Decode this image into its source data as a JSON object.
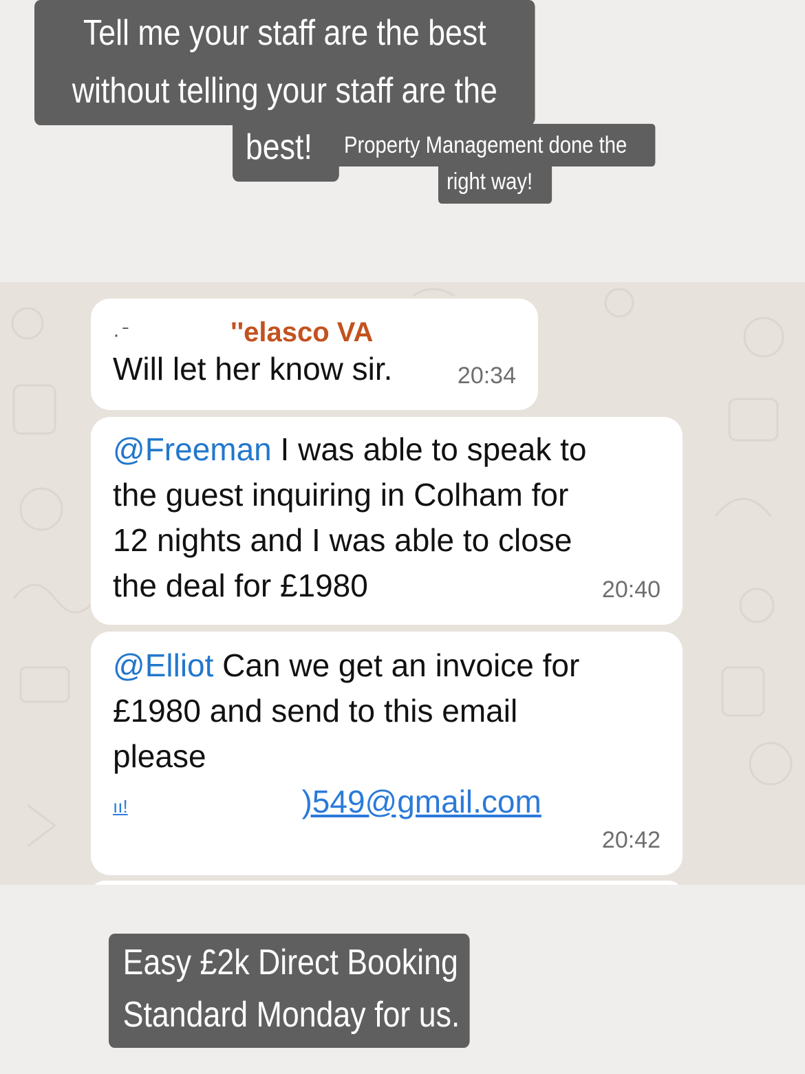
{
  "captions": {
    "top_line1": "Tell me your staff are the best",
    "top_line2": "without telling your staff are the",
    "top_line3": "best!",
    "sub_line1": "Property Management done the",
    "sub_line2": "right way!",
    "bottom_line1": "Easy £2k Direct Booking",
    "bottom_line2": "Standard Monday for us."
  },
  "chat": {
    "messages": [
      {
        "sender_prefix": "·  ̄",
        "sender": "''elasco VA",
        "text": "Will let her know sir.",
        "time": "20:34"
      },
      {
        "mention": "@Freeman",
        "lines": [
          " I was able to speak to",
          "the guest inquiring in Colham for",
          "12 nights and I was able to close",
          "the deal for £1980"
        ],
        "time": "20:40"
      },
      {
        "mention": "@Elliot",
        "lines": [
          " Can we get an invoice for",
          "£1980 and send to this email",
          "please"
        ],
        "email_prefix": "ıı!",
        "email": ")549@gmail.com",
        "time": "20:42"
      }
    ]
  },
  "colors": {
    "caption_bg": "#5f5f5f",
    "chat_bg": "#e8e2dc",
    "mention": "#2277cc",
    "sender": "#c2521f"
  }
}
